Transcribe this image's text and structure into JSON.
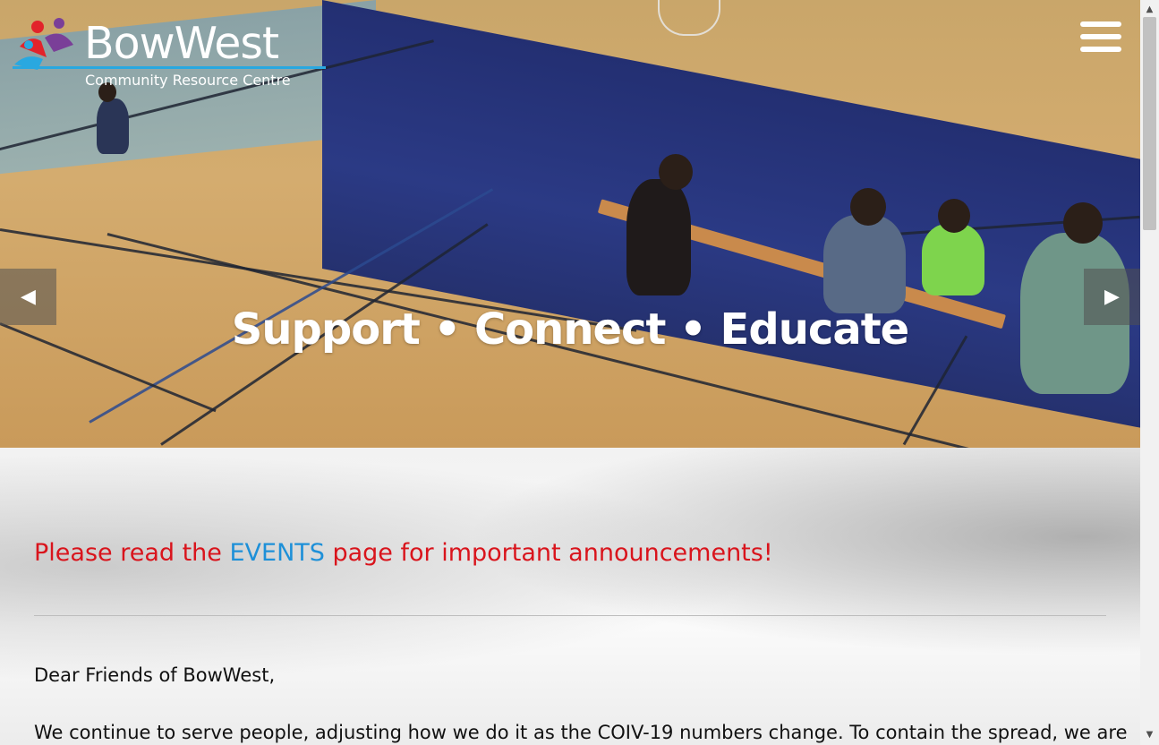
{
  "brand": {
    "name": "BowWest",
    "subtitle": "Community Resource Centre",
    "accent_color": "#29a8e0",
    "mark_colors": [
      "#e2232b",
      "#7a3f98",
      "#29a8e0"
    ]
  },
  "header": {
    "menu_icon": "hamburger-menu-icon"
  },
  "hero": {
    "caption": "Support • Connect • Educate",
    "prev_icon": "caret-left-icon",
    "next_icon": "caret-right-icon",
    "prev_glyph": "◀",
    "next_glyph": "▶"
  },
  "announcement": {
    "prefix": "Please read the ",
    "link_text": "EVENTS",
    "suffix": " page for important announcements!",
    "text_color": "#d9141c",
    "link_color": "#1e90d8"
  },
  "letter": {
    "salutation": "Dear Friends of BowWest,",
    "first_line": "We continue to serve people, adjusting how we do it as the COIV-19 numbers change. To contain the spread, we are"
  },
  "scrollbar": {
    "up_glyph": "▲",
    "down_glyph": "▼"
  }
}
